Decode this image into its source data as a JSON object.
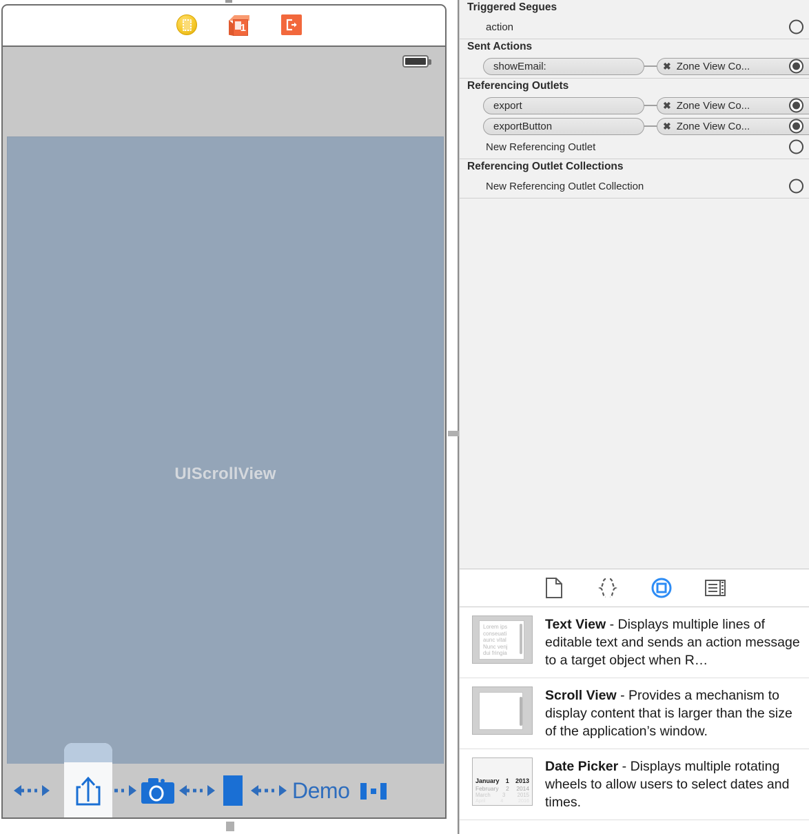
{
  "canvas": {
    "scene_dock": {
      "icons": [
        {
          "name": "view-controller-icon",
          "label": "View Controller"
        },
        {
          "name": "first-responder-icon",
          "label": "First Responder",
          "badge": "1"
        },
        {
          "name": "exit-icon",
          "label": "Exit"
        }
      ]
    },
    "status_bar": {
      "battery_label": "Battery"
    },
    "scrollview_label": "UIScrollView",
    "toolbar": {
      "items": [
        {
          "name": "flexible-space",
          "label": "Flexible Space"
        },
        {
          "name": "share-button",
          "label": "Share",
          "highlighted": true
        },
        {
          "name": "flexible-space",
          "label": "Flexible Space"
        },
        {
          "name": "camera-button",
          "label": "Camera"
        },
        {
          "name": "flexible-space",
          "label": "Flexible Space"
        },
        {
          "name": "square-button",
          "label": "Square"
        },
        {
          "name": "flexible-space",
          "label": "Flexible Space"
        },
        {
          "name": "demo-label",
          "label": "Demo"
        },
        {
          "name": "pause-button",
          "label": "Pause"
        }
      ],
      "demo_label": "Demo"
    }
  },
  "inspector": {
    "sections": [
      {
        "title": "Triggered Segues",
        "rows": [
          {
            "type": "empty",
            "label": "action",
            "connector": "empty"
          }
        ]
      },
      {
        "title": "Sent Actions",
        "rows": [
          {
            "type": "connection",
            "left": "showEmail:",
            "right": "Zone View Co...",
            "connector": "filled"
          }
        ]
      },
      {
        "title": "Referencing Outlets",
        "rows": [
          {
            "type": "connection",
            "left": "export",
            "right": "Zone View Co...",
            "connector": "filled"
          },
          {
            "type": "connection",
            "left": "exportButton",
            "right": "Zone View Co...",
            "connector": "filled"
          },
          {
            "type": "empty",
            "label": "New Referencing Outlet",
            "connector": "empty"
          }
        ]
      },
      {
        "title": "Referencing Outlet Collections",
        "rows": [
          {
            "type": "empty",
            "label": "New Referencing Outlet Collection",
            "connector": "empty"
          }
        ]
      }
    ]
  },
  "library": {
    "tabs": [
      {
        "name": "file-template-library-tab",
        "icon": "document-icon",
        "selected": false
      },
      {
        "name": "code-snippet-library-tab",
        "icon": "braces-icon",
        "selected": false
      },
      {
        "name": "object-library-tab",
        "icon": "object-icon",
        "selected": true
      },
      {
        "name": "media-library-tab",
        "icon": "media-icon",
        "selected": false
      }
    ],
    "items": [
      {
        "title": "Text View",
        "description": " - Displays multiple lines of editable text and sends an action message to a target object when R…",
        "thumb": "text-view-thumb",
        "thumb_lines": [
          "Lorem ips",
          "conseuati",
          "aunc vital",
          "Nunc venj",
          "dui fringia"
        ]
      },
      {
        "title": "Scroll View",
        "description": " - Provides a mechanism to display content that is larger than the size of the application’s window.",
        "thumb": "scroll-view-thumb"
      },
      {
        "title": "Date Picker",
        "description": " - Displays multiple rotating wheels to allow users to select dates and times.",
        "thumb": "date-picker-thumb",
        "thumb_rows": [
          [
            "January",
            "1",
            "2013"
          ],
          [
            "February",
            "2",
            "2014"
          ],
          [
            "March",
            "3",
            "2015"
          ],
          [
            "April",
            "4",
            "2016"
          ]
        ]
      }
    ]
  },
  "colors": {
    "accent_blue": "#2e6dbd",
    "selection_blue": "#1a8cff",
    "scrollview_fill": "#94a5b8",
    "chrome_gray": "#c8c8c8",
    "orange": "#f2683c",
    "yellow": "#f6c92c"
  }
}
